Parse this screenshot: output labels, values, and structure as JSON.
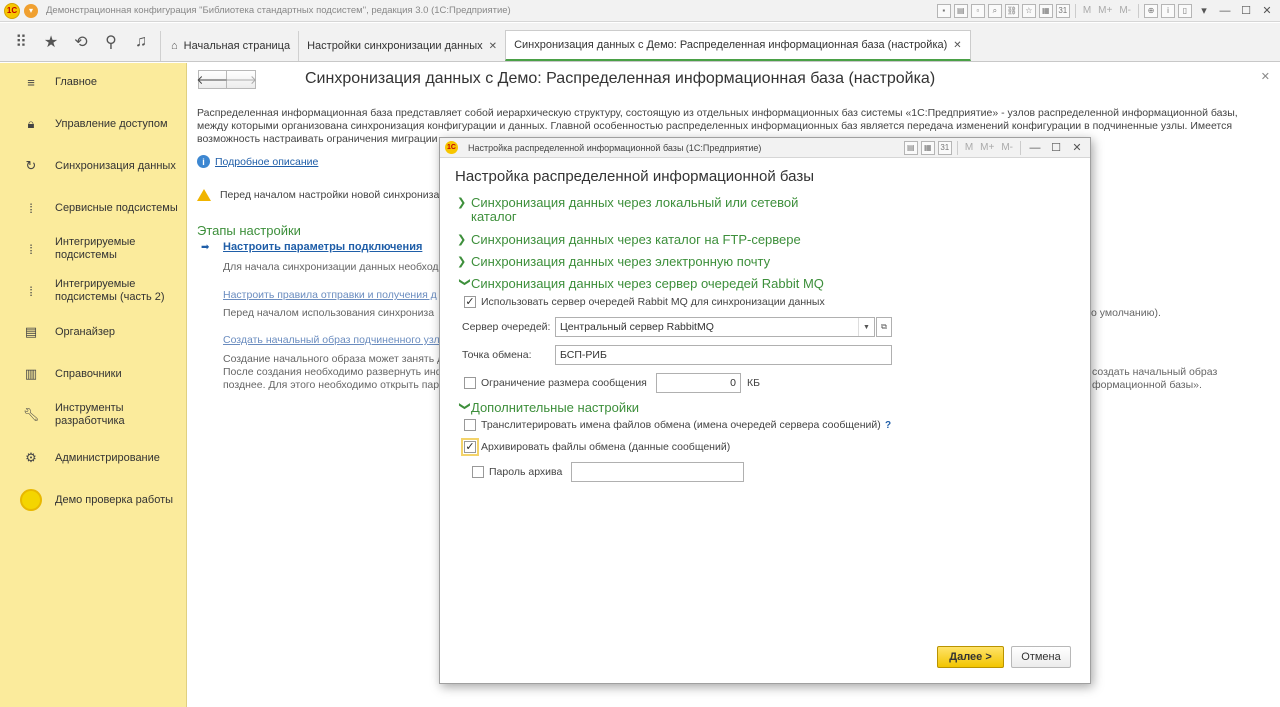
{
  "titlebar": {
    "app_title": "Демонстрационная конфигурация \"Библиотека стандартных подсистем\", редакция 3.0  (1С:Предприятие)",
    "memory_buttons": [
      "M",
      "M+",
      "M-"
    ]
  },
  "tabs": [
    {
      "label": "Начальная страница",
      "closable": false
    },
    {
      "label": "Настройки синхронизации данных",
      "closable": true
    },
    {
      "label": "Синхронизация данных с Демо: Распределенная информационная база (настройка)",
      "closable": true,
      "active": true
    }
  ],
  "sidebar": {
    "items": [
      {
        "label": "Главное",
        "icon": "menu-icon"
      },
      {
        "label": "Управление доступом",
        "icon": "lock-icon"
      },
      {
        "label": "Синхронизация данных",
        "icon": "sync-icon"
      },
      {
        "label": "Сервисные подсистемы",
        "icon": "subsystems-icon"
      },
      {
        "label": "Интегрируемые подсистемы",
        "icon": "subsystems-icon"
      },
      {
        "label": "Интегрируемые подсистемы (часть 2)",
        "icon": "subsystems-icon"
      },
      {
        "label": "Органайзер",
        "icon": "organizer-icon"
      },
      {
        "label": "Справочники",
        "icon": "book-icon"
      },
      {
        "label": "Инструменты разработчика",
        "icon": "wrench-icon"
      },
      {
        "label": "Администрирование",
        "icon": "gear-icon"
      },
      {
        "label": "Демо проверка работы",
        "icon": "demo-circle-icon"
      }
    ],
    "accent": "#fbeb9c"
  },
  "main": {
    "title": "Синхронизация данных с Демо: Распределенная информационная база (настройка)",
    "intro_line1": "Распределенная информационная база представляет собой иерархическую структуру, состоящую из отдельных информационных баз системы «1С:Предприятие» - узлов распределенной информационной базы,",
    "intro_line2": "между которыми организована синхронизация конфигурации и данных. Главной особенностью распределенных информационных баз является передача изменений конфигурации в подчиненные узлы. Имеется",
    "intro_line3": "возможность настраивать ограничения миграции",
    "details_link": "Подробное описание",
    "warning": "Перед началом настройки новой синхронизаци",
    "stages_title": "Этапы настройки",
    "stage1_link": "Настроить параметры подключения",
    "stage1_text": "Для начала синхронизации данных необход",
    "stage2_link": "Настроить правила отправки и получения д",
    "stage2_text": "Перед началом использования синхрониза",
    "stage2_tail": "о умолчанию).",
    "stage3_link": "Создать начальный образ подчиненного узл",
    "stage3_text1": "Создание начального образа может занять д",
    "stage3_text2": "После создания необходимо развернуть инф",
    "stage3_text3": "позднее. Для этого необходимо открыть пар",
    "stage3_tail1": "создать начальный образ",
    "stage3_tail2": "формационной базы»."
  },
  "dialog": {
    "window_title": "Настройка распределенной информационной базы  (1С:Предприятие)",
    "heading": "Настройка распределенной информационной базы",
    "groups": {
      "local": "Синхронизация данных через локальный или сетевой каталог",
      "ftp": "Синхронизация данных через каталог на FTP-сервере",
      "email": "Синхронизация данных через электронную почту",
      "rabbit": "Синхронизация данных через сервер очередей Rabbit MQ",
      "extra": "Дополнительные настройки"
    },
    "use_rabbit_label": "Использовать сервер очередей Rabbit MQ для синхронизации данных",
    "use_rabbit_checked": true,
    "queue_server_label": "Сервер очередей:",
    "queue_server_value": "Центральный сервер RabbitMQ",
    "exchange_label": "Точка обмена:",
    "exchange_value": "БСП-РИБ",
    "limit_label": "Ограничение размера сообщения",
    "limit_checked": false,
    "limit_value": "0",
    "limit_unit": "КБ",
    "translit_label": "Транслитерировать имена файлов обмена (имена очередей сервера сообщений)",
    "translit_checked": false,
    "help_mark": "?",
    "archive_label": "Архивировать файлы обмена (данные сообщений)",
    "archive_checked": true,
    "password_label": "Пароль архива",
    "password_checked": false,
    "password_value": "",
    "next_button": "Далее >",
    "cancel_button": "Отмена"
  }
}
